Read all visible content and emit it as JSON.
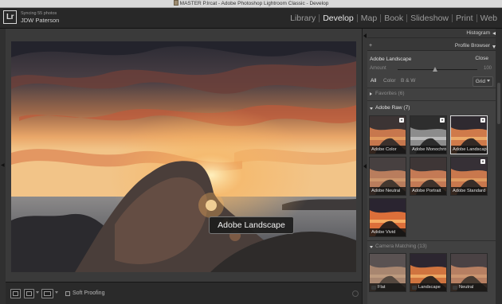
{
  "window": {
    "title": "MASTER P.lrcat - Adobe Photoshop Lightroom Classic - Develop"
  },
  "identity": {
    "logo": "Lr",
    "sync_status": "Syncing 55 photos",
    "user": "JDW Paterson"
  },
  "modules": [
    {
      "label": "Library",
      "active": false
    },
    {
      "label": "Develop",
      "active": true
    },
    {
      "label": "Map",
      "active": false
    },
    {
      "label": "Book",
      "active": false
    },
    {
      "label": "Slideshow",
      "active": false
    },
    {
      "label": "Print",
      "active": false
    },
    {
      "label": "Web",
      "active": false
    }
  ],
  "overlay": {
    "profile_name": "Adobe Landscape"
  },
  "toolbar": {
    "soft_proofing_label": "Soft Proofing",
    "soft_proofing_checked": false
  },
  "panel": {
    "histogram_header": "Histogram",
    "profile_browser_header": "Profile Browser",
    "current_profile": "Adobe Landscape",
    "close_label": "Close",
    "amount_label": "Amount",
    "amount_value": "100",
    "filters": [
      "All",
      "Color",
      "B & W"
    ],
    "active_filter": "All",
    "grid_label": "Grid",
    "groups": {
      "favorites": "Favorites (6)",
      "adobe_raw": "Adobe Raw (7)",
      "camera_matching": "Camera Matching (13)"
    },
    "adobe_raw_profiles": [
      {
        "name": "Adobe Color",
        "selected": false,
        "mono": false
      },
      {
        "name": "Adobe Monochrome",
        "selected": false,
        "mono": true
      },
      {
        "name": "Adobe Landscape",
        "selected": true,
        "mono": false
      },
      {
        "name": "Adobe Neutral",
        "selected": false,
        "mono": false
      },
      {
        "name": "Adobe Portrait",
        "selected": false,
        "mono": false
      },
      {
        "name": "Adobe Standard",
        "selected": false,
        "mono": false
      },
      {
        "name": "Adobe Vivid",
        "selected": false,
        "mono": false
      }
    ],
    "camera_profiles": [
      "Flat",
      "Landscape",
      "Neutral"
    ]
  },
  "colors": {
    "panel_bg": "#414141",
    "text": "#d0d0d0",
    "app_bg": "#1b1b1b"
  }
}
